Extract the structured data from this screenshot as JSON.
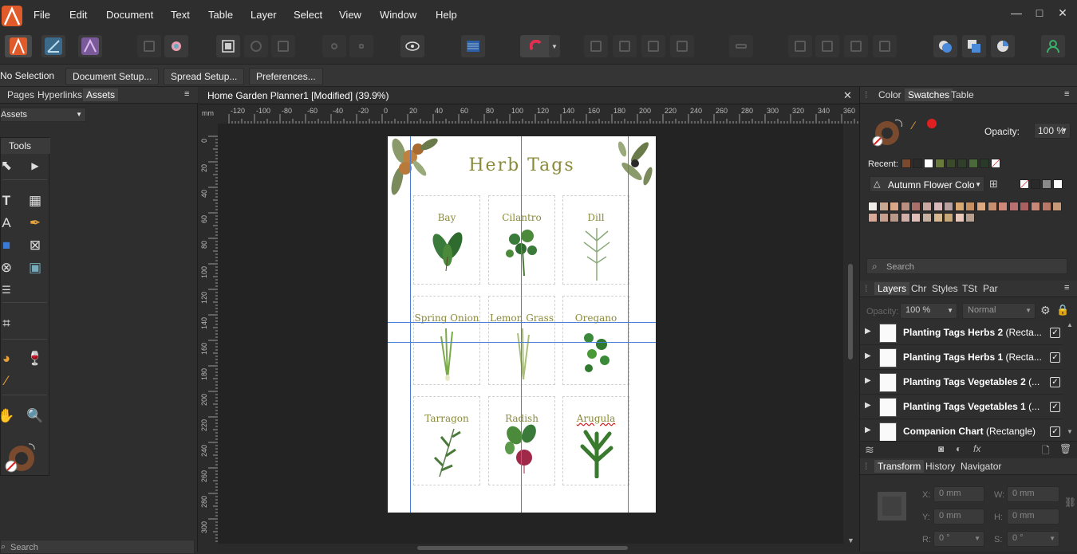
{
  "menubar": {
    "items": [
      "File",
      "Edit",
      "Document",
      "Text",
      "Table",
      "Layer",
      "Select",
      "View",
      "Window",
      "Help"
    ]
  },
  "context": {
    "selection": "No Selection",
    "buttons": [
      "Document Setup...",
      "Spread Setup...",
      "Preferences..."
    ]
  },
  "left": {
    "tabs": [
      "Pages",
      "Hyperlinks",
      "Assets"
    ],
    "assets_dropdown": "Assets",
    "tools_title": "Tools",
    "search_placeholder": "Search"
  },
  "document": {
    "tab_title": "Home Garden Planner1 [Modified] (39.9%)",
    "ruler_unit": "mm",
    "h_ticks": [
      "-120",
      "-100",
      "-80",
      "-60",
      "-40",
      "-20",
      "0",
      "20",
      "40",
      "60",
      "80",
      "100",
      "120",
      "140",
      "160",
      "180",
      "200",
      "220",
      "240",
      "260",
      "280",
      "300",
      "320",
      "340",
      "360"
    ],
    "v_ticks": [
      "0",
      "20",
      "40",
      "60",
      "80",
      "100",
      "120",
      "140",
      "160",
      "180",
      "200",
      "220",
      "240",
      "260",
      "280",
      "300"
    ],
    "page_title": "Herb Tags",
    "herbs": [
      "Bay",
      "Cilantro",
      "Dill",
      "Spring Onion",
      "Lemon Grass",
      "Oregano",
      "Tarragon",
      "Radish",
      "Arugula"
    ]
  },
  "right": {
    "top_tabs": [
      "Color",
      "Swatches",
      "Table"
    ],
    "opacity_label": "Opacity:",
    "opacity_value": "100 %",
    "recent_label": "Recent:",
    "palette_name": "Autumn Flower Colour",
    "search_placeholder": "Search",
    "layer_tabs": [
      "Layers",
      "Chr",
      "Styles",
      "TSt",
      "Par"
    ],
    "layer_opacity": "100 %",
    "blend_mode": "Normal",
    "layers": [
      {
        "bold": "Planting Tags Herbs 2",
        "rest": " (Recta..."
      },
      {
        "bold": "Planting Tags Herbs 1",
        "rest": " (Recta..."
      },
      {
        "bold": "Planting Tags Vegetables 2",
        "rest": " (..."
      },
      {
        "bold": "Planting Tags Vegetables 1",
        "rest": " (..."
      },
      {
        "bold": "Companion Chart",
        "rest": " (Rectangle)"
      }
    ],
    "transform_tabs": [
      "Transform",
      "History",
      "Navigator"
    ],
    "transform": {
      "x": "0 mm",
      "y": "0 mm",
      "w": "0 mm",
      "h": "0 mm",
      "r": "0 °",
      "s": "0 °"
    },
    "field_labels": {
      "x": "X:",
      "y": "Y:",
      "w": "W:",
      "h": "H:",
      "r": "R:",
      "s": "S:"
    },
    "colors": {
      "accent": "#e8a23a",
      "fill_brown": "#7a4a2e",
      "stroke_red": "#e02020"
    }
  }
}
